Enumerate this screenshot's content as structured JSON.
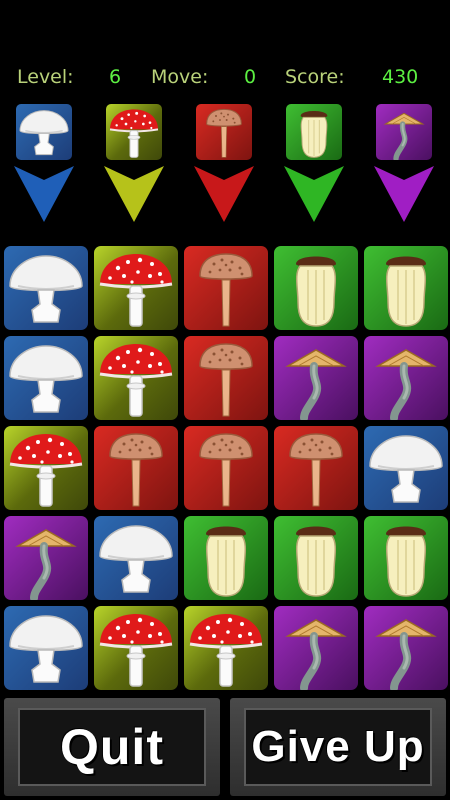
{
  "status": {
    "level_label": "Level:",
    "level_value": "6",
    "move_label": "Move:",
    "move_value": "0",
    "score_label": "Score:",
    "score_value": "430"
  },
  "colors": {
    "white": "#1f4f9a",
    "red": "#a2b01c",
    "brown": "#b21a16",
    "king": "#2ea624",
    "lib": "#8e22b0"
  },
  "targets": [
    {
      "mushroom": "white-mushroom-icon",
      "arrow_color": "#1f5fb8"
    },
    {
      "mushroom": "red-mushroom-icon",
      "arrow_color": "#b6c21a"
    },
    {
      "mushroom": "brown-mushroom-icon",
      "arrow_color": "#c8181a"
    },
    {
      "mushroom": "king-mushroom-icon",
      "arrow_color": "#2fb624"
    },
    {
      "mushroom": "lib-mushroom-icon",
      "arrow_color": "#a01ec4"
    }
  ],
  "board": [
    [
      "white",
      "red",
      "brown",
      "king",
      "king"
    ],
    [
      "white",
      "red",
      "brown",
      "lib",
      "lib"
    ],
    [
      "red",
      "brown",
      "brown",
      "brown",
      "white"
    ],
    [
      "lib",
      "white",
      "king",
      "king",
      "king"
    ],
    [
      "white",
      "red",
      "red",
      "lib",
      "lib"
    ]
  ],
  "buttons": {
    "quit_label": "Quit",
    "give_up_label": "Give Up"
  }
}
